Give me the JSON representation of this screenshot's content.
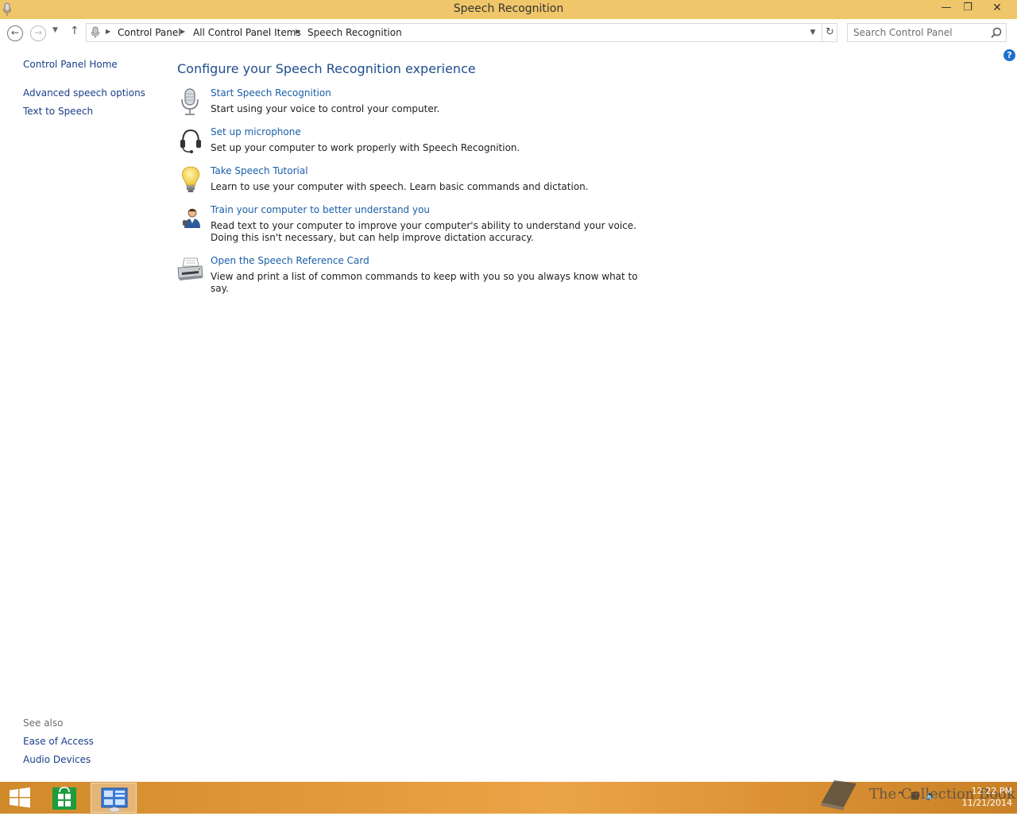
{
  "window": {
    "title": "Speech Recognition",
    "minimize_label": "—",
    "maximize_label": "❐",
    "close_label": "✕"
  },
  "nav": {
    "back_icon": "back-arrow-icon",
    "forward_icon": "forward-arrow-icon",
    "breadcrumbs": [
      "Control Panel",
      "All Control Panel Items",
      "Speech Recognition"
    ],
    "search_placeholder": "Search Control Panel"
  },
  "sidebar": {
    "home": "Control Panel Home",
    "links": [
      "Advanced speech options",
      "Text to Speech"
    ],
    "see_also_title": "See also",
    "see_also": [
      "Ease of Access",
      "Audio Devices"
    ]
  },
  "main": {
    "heading": "Configure your Speech Recognition experience",
    "tasks": [
      {
        "icon": "microphone-icon",
        "title": "Start Speech Recognition",
        "desc": "Start using your voice to control your computer."
      },
      {
        "icon": "headset-icon",
        "title": "Set up microphone",
        "desc": "Set up your computer to work properly with Speech Recognition."
      },
      {
        "icon": "lightbulb-icon",
        "title": "Take Speech Tutorial",
        "desc": "Learn to use your computer with speech.  Learn basic commands and dictation."
      },
      {
        "icon": "user-training-icon",
        "title": "Train your computer to better understand you",
        "desc": "Read text to your computer to improve your computer's ability to understand your voice.  Doing this isn't necessary, but can help improve dictation accuracy."
      },
      {
        "icon": "printer-icon",
        "title": "Open the Speech Reference Card",
        "desc": "View and print a list of common commands to keep with you so you always know what to say."
      }
    ]
  },
  "help_label": "?",
  "taskbar": {
    "clock_time": "12:22 PM",
    "clock_date": "11/21/2014",
    "watermark": "The Collection Book"
  },
  "colors": {
    "titlebar": "#f0c66a",
    "link": "#1a5ea8",
    "heading": "#1e4e8c"
  }
}
